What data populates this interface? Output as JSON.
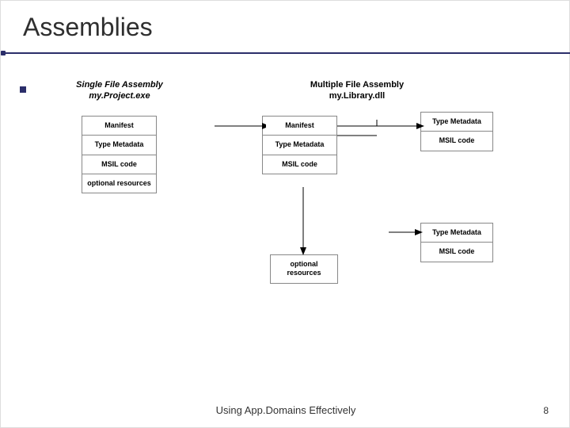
{
  "title": "Assemblies",
  "footer": "Using App.Domains Effectively",
  "page_number": "8",
  "single": {
    "heading_line1": "Single File Assembly",
    "heading_line2": "my.Project.exe",
    "cells": {
      "manifest": "Manifest",
      "type_meta": "Type Metadata",
      "msil": "MSIL code",
      "optional": "optional resources"
    }
  },
  "multi": {
    "heading_line1": "Multiple File Assembly",
    "heading_line2": "my.Library.dll",
    "main_cells": {
      "manifest": "Manifest",
      "type_meta": "Type Metadata",
      "msil": "MSIL code"
    },
    "optional": "optional resources",
    "module_a": {
      "type_meta": "Type Metadata",
      "msil": "MSIL code"
    },
    "module_b": {
      "type_meta": "Type Metadata",
      "msil": "MSIL code"
    }
  }
}
